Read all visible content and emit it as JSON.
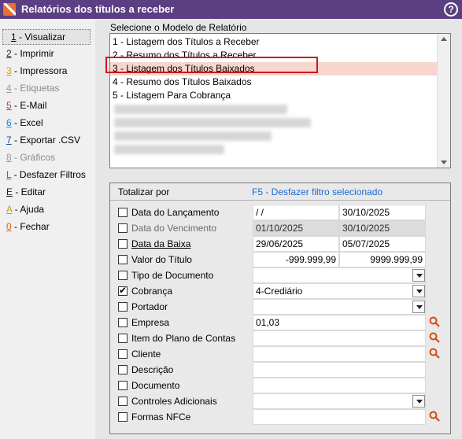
{
  "window": {
    "title": "Relatórios dos títulos a receber",
    "help": "?"
  },
  "sidebar": {
    "items": [
      {
        "key": "1",
        "label": " - Visualizar"
      },
      {
        "key": "2",
        "label": " - Imprimir"
      },
      {
        "key": "3",
        "label": " - Impressora"
      },
      {
        "key": "4",
        "label": " - Etiquetas"
      },
      {
        "key": "5",
        "label": " - E-Mail"
      },
      {
        "key": "6",
        "label": " - Excel"
      },
      {
        "key": "7",
        "label": " - Exportar .CSV"
      },
      {
        "key": "8",
        "label": " - Gráficos"
      },
      {
        "key": "L",
        "label": " - Desfazer Filtros"
      },
      {
        "key": "E",
        "label": " - Editar"
      },
      {
        "key": "A",
        "label": " - Ajuda"
      },
      {
        "key": "0",
        "label": " - Fechar"
      }
    ]
  },
  "report_model": {
    "label": "Selecione o Modelo de Relatório",
    "options": [
      "1 - Listagem dos Títulos a Receber",
      "2 - Resumo dos Títulos a Receber",
      "3 - Listagem dos Títulos Baixados",
      "4 - Resumo dos Títulos Baixados",
      "5 - Listagem Para Cobrança"
    ],
    "selected": "3 - Listagem dos Títulos Baixados"
  },
  "filters": {
    "totalizar_label": "Totalizar por",
    "f5_label": "F5 - Desfazer filtro selecionado",
    "rows": [
      {
        "label": "Data do Lançamento",
        "checked": false,
        "from": " /  /",
        "to": "30/10/2025"
      },
      {
        "label": "Data do Vencimento",
        "checked": false,
        "from": "01/10/2025",
        "to": "30/10/2025"
      },
      {
        "label": "Data da Baixa",
        "checked": false,
        "from": "29/06/2025",
        "to": "05/07/2025"
      },
      {
        "label": "Valor do Título",
        "checked": false,
        "from": "-999.999,99",
        "to": "9999.999,99"
      },
      {
        "label": "Tipo de Documento",
        "checked": false,
        "value": ""
      },
      {
        "label": "Cobrança",
        "checked": true,
        "value": "4-Crediário"
      },
      {
        "label": "Portador",
        "checked": false,
        "value": ""
      },
      {
        "label": "Empresa",
        "checked": false,
        "value": "01,03"
      },
      {
        "label": "Item do Plano de Contas",
        "checked": false,
        "value": ""
      },
      {
        "label": "Cliente",
        "checked": false,
        "value": ""
      },
      {
        "label": "Descrição",
        "checked": false,
        "value": ""
      },
      {
        "label": "Documento",
        "checked": false,
        "value": ""
      },
      {
        "label": "Controles Adicionais",
        "checked": false,
        "value": ""
      },
      {
        "label": "Formas NFCe",
        "checked": false,
        "value": ""
      }
    ]
  },
  "colors": {
    "titlebar": "#5b3f82",
    "selection": "#f7d6cf",
    "highlight_border": "#d01818",
    "link": "#1a6ad1",
    "lens": "#d9480f"
  }
}
